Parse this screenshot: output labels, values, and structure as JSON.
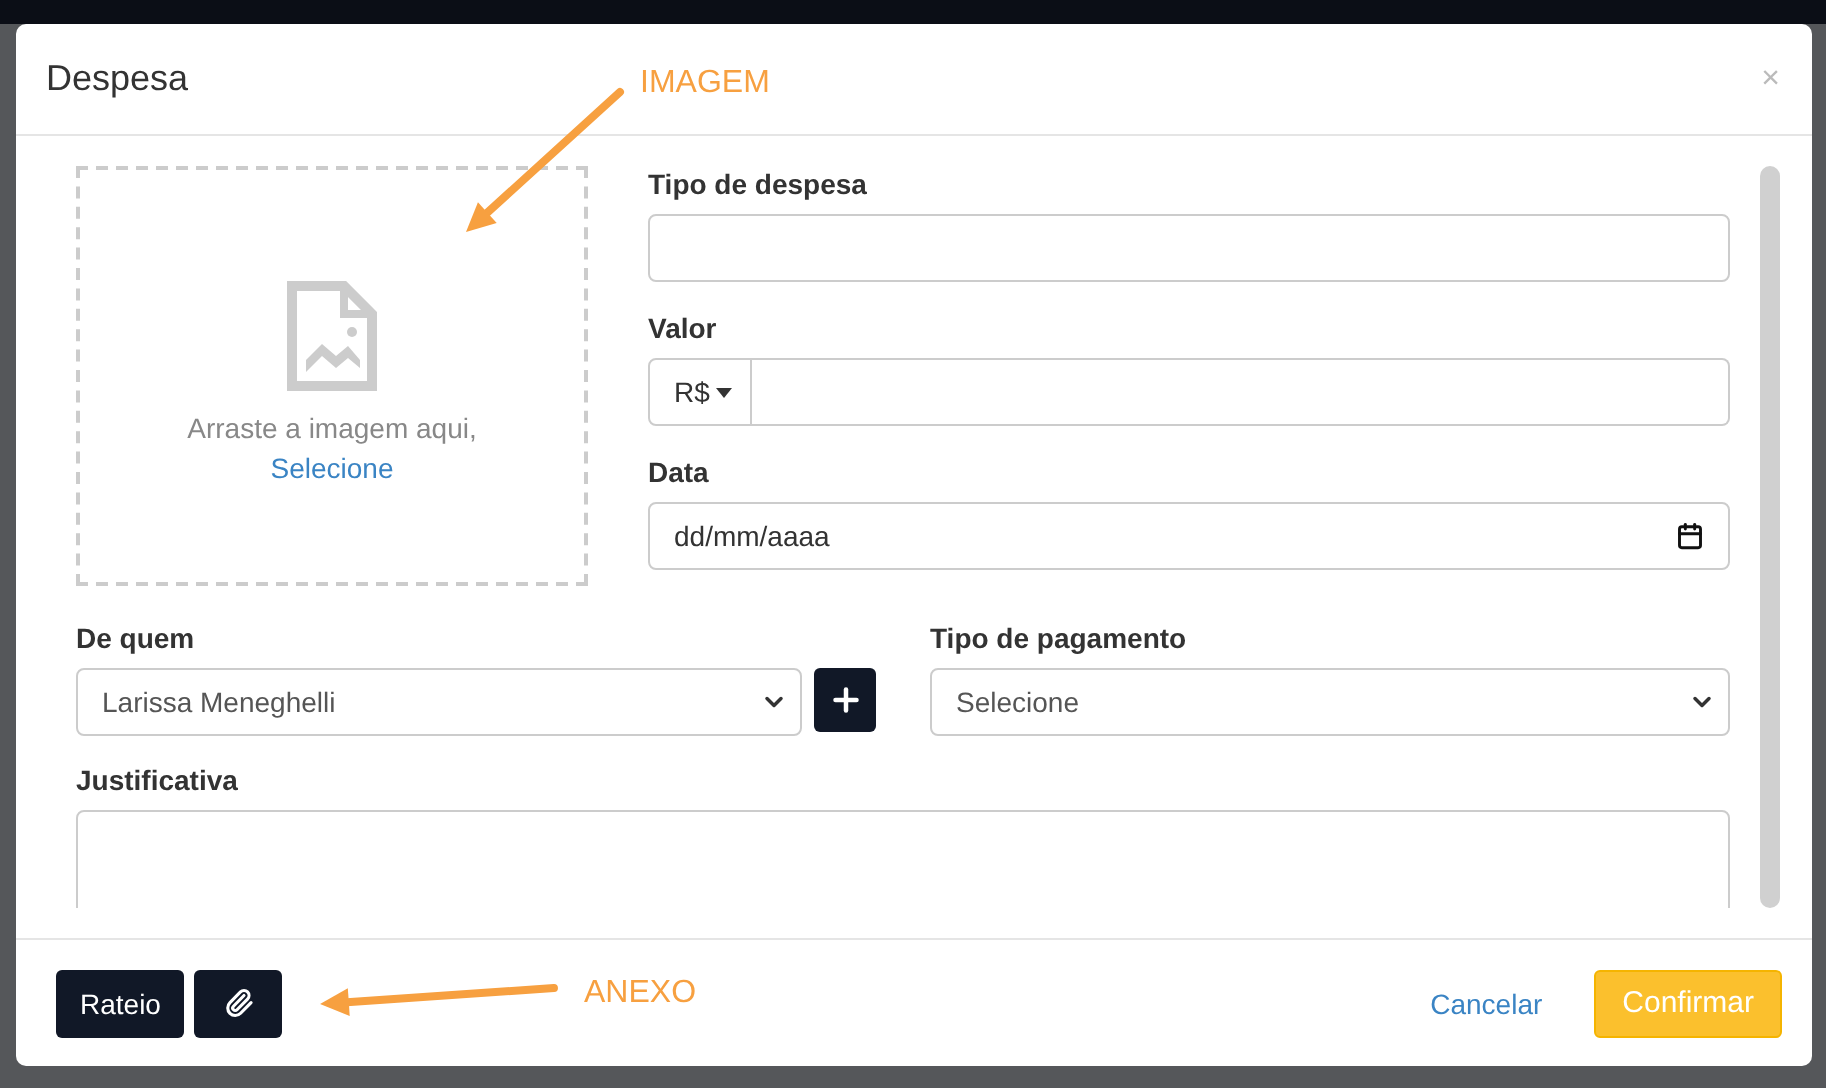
{
  "modal": {
    "title": "Despesa",
    "close": "×"
  },
  "image_drop": {
    "text": "Arraste a imagem aqui,",
    "link": "Selecione"
  },
  "fields": {
    "tipo_despesa": {
      "label": "Tipo de despesa"
    },
    "valor": {
      "label": "Valor",
      "currency": "R$"
    },
    "data": {
      "label": "Data",
      "placeholder": "dd/mm/aaaa"
    },
    "de_quem": {
      "label": "De quem",
      "value": "Larissa Meneghelli"
    },
    "tipo_pagamento": {
      "label": "Tipo de pagamento",
      "value": "Selecione"
    },
    "justificativa": {
      "label": "Justificativa"
    }
  },
  "footer": {
    "rateio": "Rateio",
    "cancel": "Cancelar",
    "confirm": "Confirmar"
  },
  "annotations": [
    {
      "text": "IMAGEM"
    },
    {
      "text": "ANEXO"
    }
  ]
}
